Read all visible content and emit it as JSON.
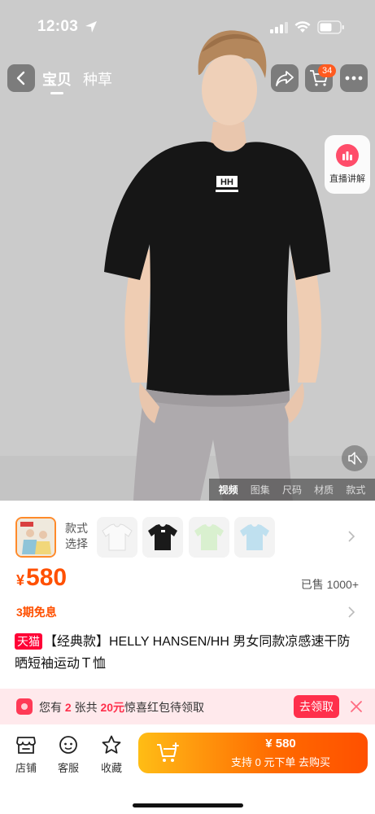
{
  "status_bar": {
    "time": "12:03"
  },
  "nav": {
    "tabs": [
      {
        "label": "宝贝",
        "active": true
      },
      {
        "label": "种草",
        "active": false
      }
    ],
    "cart_badge": "34"
  },
  "live": {
    "label": "直播讲解"
  },
  "media_tabs": [
    {
      "label": "视频",
      "active": true
    },
    {
      "label": "图集",
      "active": false
    },
    {
      "label": "尺码",
      "active": false
    },
    {
      "label": "材质",
      "active": false
    },
    {
      "label": "款式",
      "active": false
    }
  ],
  "variants": {
    "label": "款式选择",
    "thumbs": [
      {
        "name": "white-tee",
        "color": "#f4f4f4"
      },
      {
        "name": "black-tee",
        "color": "#1a1a1a"
      },
      {
        "name": "mint-tee",
        "color": "#d9f0cf"
      },
      {
        "name": "blue-tee",
        "color": "#bfe0ef"
      }
    ]
  },
  "price": {
    "symbol": "¥",
    "value": "580"
  },
  "sold": "已售 1000+",
  "installment": "3期免息",
  "title": {
    "tag": "天猫",
    "text": "【经典款】HELLY HANSEN/HH 男女同款凉感速干防晒短袖运动Ｔ恤"
  },
  "coupon": {
    "text_prefix": "您有",
    "count": "2",
    "text_mid": "张共",
    "amount": "20元",
    "text_suffix": "惊喜红包待领取",
    "button": "去领取"
  },
  "bottom_bar": {
    "items": [
      {
        "label": "店铺",
        "icon": "store-icon"
      },
      {
        "label": "客服",
        "icon": "customer-service-icon"
      },
      {
        "label": "收藏",
        "icon": "star-icon"
      }
    ],
    "buy_price": "¥ 580",
    "buy_sub": "支持 0 元下单  去购买"
  },
  "colors": {
    "accent": "#ff5000",
    "coupon_red": "#ff2f4b",
    "tmall_red": "#ff0036"
  }
}
